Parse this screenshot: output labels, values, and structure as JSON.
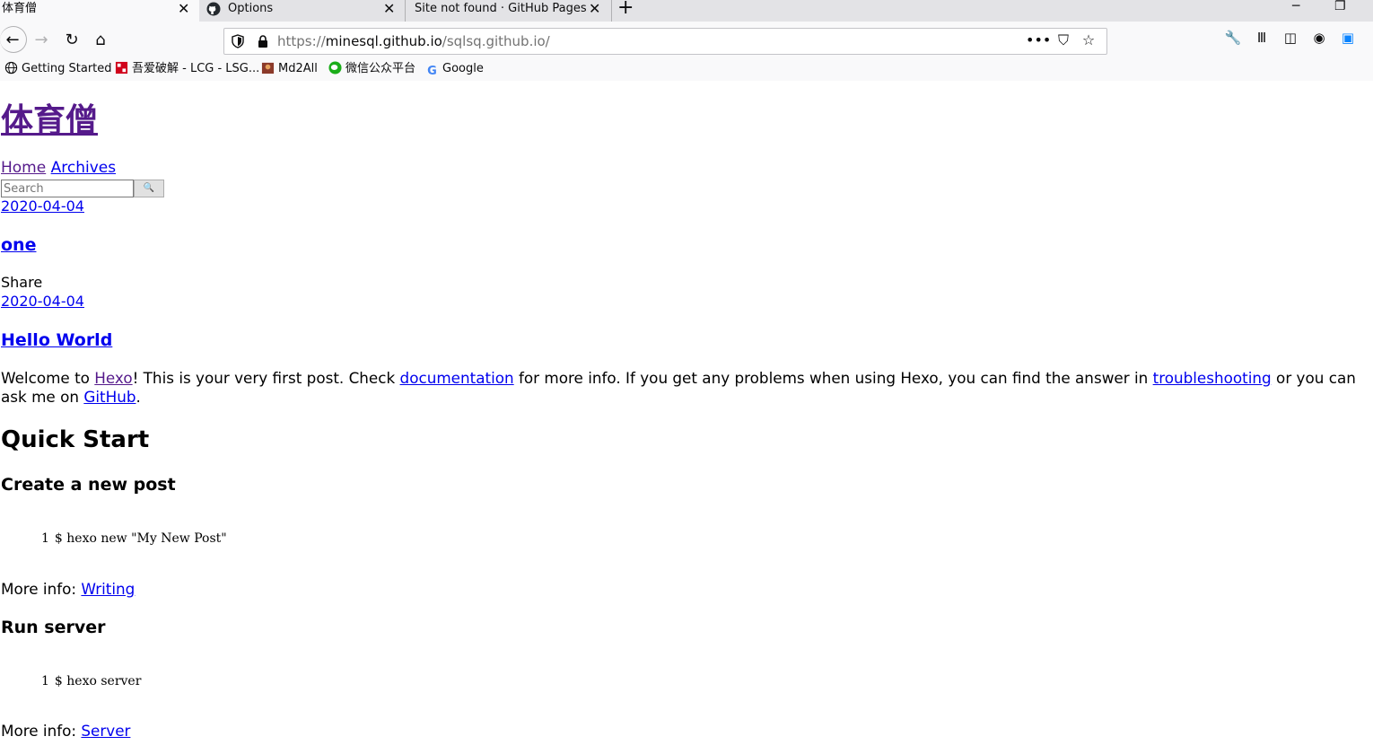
{
  "browser": {
    "tabs": [
      {
        "label": "体育僧",
        "active": true
      },
      {
        "label": "Options",
        "active": false
      },
      {
        "label": "Site not found · GitHub Pages",
        "active": false
      }
    ],
    "url": {
      "scheme": "https://",
      "host": "minesql.github.io",
      "path": "/sqlsq.github.io/"
    },
    "bookmarks": [
      {
        "label": "Getting Started",
        "icon": "globe-icon"
      },
      {
        "label": "吾爱破解 - LCG - LSG...",
        "icon": "52pojie-icon"
      },
      {
        "label": "Md2All",
        "icon": "md2all-icon"
      },
      {
        "label": "微信公众平台",
        "icon": "wechat-icon"
      },
      {
        "label": "Google",
        "icon": "google-icon"
      }
    ],
    "colors": {
      "tabstrip": "#e3e3e6",
      "toolbar": "#f9f9fa",
      "accent": "#0a84ff"
    }
  },
  "page": {
    "site_title": "体育僧",
    "nav": {
      "home": "Home",
      "archives": "Archives"
    },
    "search": {
      "placeholder": "Search",
      "button": "🔍"
    },
    "posts": [
      {
        "date": "2020-04-04",
        "title": "one",
        "share": "Share"
      },
      {
        "date": "2020-04-04",
        "title": "Hello World"
      }
    ],
    "intro": {
      "t1": "Welcome to ",
      "link_hexo": "Hexo",
      "t2": "! This is your very first post. Check ",
      "link_docs": "documentation",
      "t3": " for more info. If you get any problems when using Hexo, you can find the answer in ",
      "link_trouble": "troubleshooting",
      "t4": " or you can ask me on ",
      "link_github": "GitHub",
      "t5": "."
    },
    "quick_start": "Quick Start",
    "sections": [
      {
        "heading": "Create a new post",
        "line_no": "1",
        "code": "$ hexo new \"My New Post\"",
        "more_label": "More info: ",
        "more_link": "Writing"
      },
      {
        "heading": "Run server",
        "line_no": "1",
        "code": "$ hexo server",
        "more_label": "More info: ",
        "more_link": "Server"
      }
    ],
    "colors": {
      "link": "#0000ee",
      "visited": "#551a8b"
    }
  }
}
